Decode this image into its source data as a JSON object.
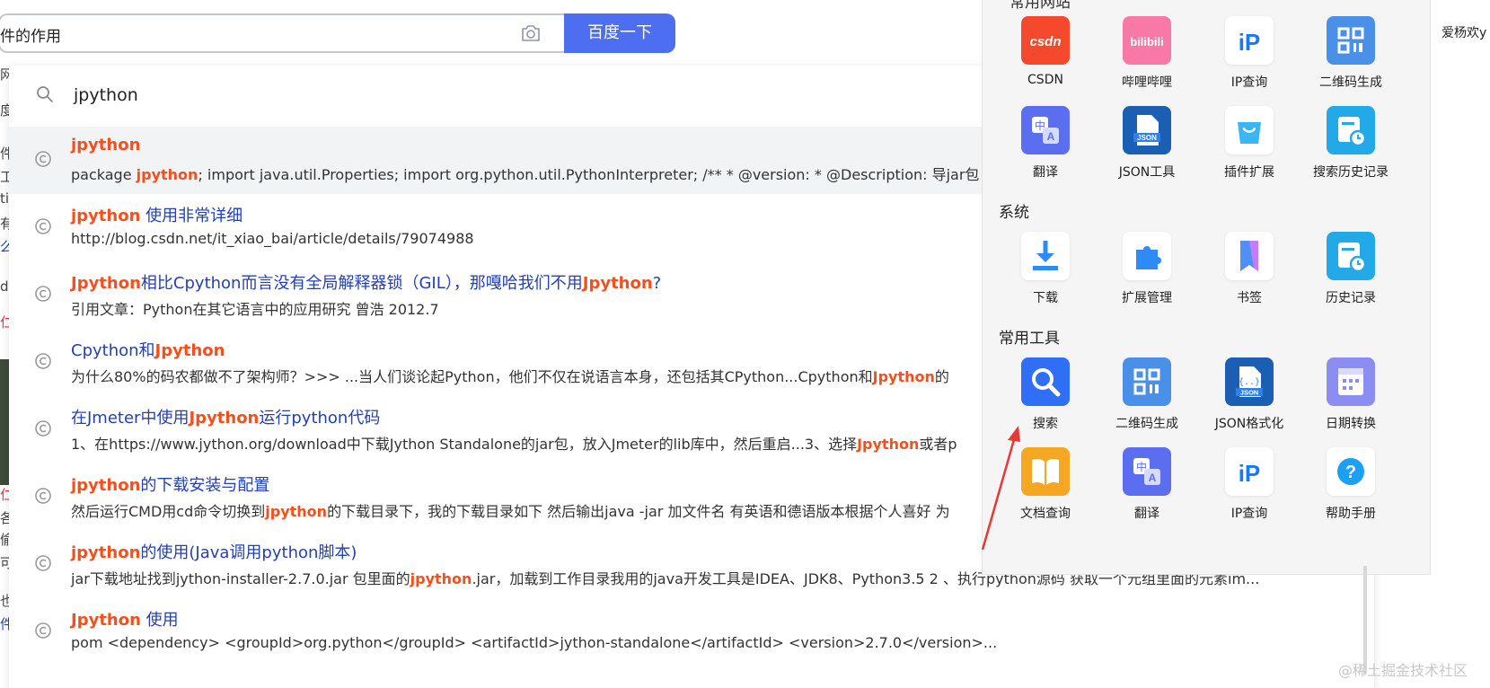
{
  "search": {
    "query": "件的作用",
    "button": "百度一下"
  },
  "left_fragments": {
    "f1": "网",
    "f2": "度",
    "f3": "件",
    "f4": "工",
    "f5": "tiv",
    "f6": "有",
    "f7": "么",
    "f8": "da",
    "f9": "仁",
    "f10": "仁",
    "f11": "各",
    "f12": "偷",
    "f13": "可",
    "f14": "也",
    "f15": "件"
  },
  "suggest": {
    "query": "jpython",
    "items": [
      {
        "title": [
          {
            "t": "jpython",
            "h": true
          }
        ],
        "desc": [
          {
            "t": "package ",
            "h": false
          },
          {
            "t": "jpython",
            "h": true
          },
          {
            "t": "; import java.util.Properties; import org.python.util.PythonInterpreter; /** * @version: * @Description: 导jar包",
            "h": false
          }
        ]
      },
      {
        "title": [
          {
            "t": "jpython",
            "h": true
          },
          {
            "t": " 使用非常详细",
            "h": false
          }
        ],
        "desc": [
          {
            "t": "http://blog.csdn.net/it_xiao_bai/article/details/79074988",
            "h": false
          }
        ]
      },
      {
        "title": [
          {
            "t": "Jpython",
            "h": true
          },
          {
            "t": "相比Cpython而言没有全局解释器锁（GIL），那嘎哈我们不用",
            "h": false
          },
          {
            "t": "Jpython",
            "h": true
          },
          {
            "t": "?",
            "h": false
          }
        ],
        "desc": [
          {
            "t": "引用文章：Python在其它语言中的应用研究 曾浩 2012.7",
            "h": false
          }
        ]
      },
      {
        "title": [
          {
            "t": "Cpython和",
            "h": false
          },
          {
            "t": "Jpython",
            "h": true
          }
        ],
        "desc": [
          {
            "t": "为什么80%的码农都做不了架构师？>>>   ...当人们谈论起Python，他们不仅在说语言本身，还包括其CPython...Cpython和",
            "h": false
          },
          {
            "t": "Jpython",
            "h": true
          },
          {
            "t": "的",
            "h": false
          }
        ]
      },
      {
        "title": [
          {
            "t": "在Jmeter中使用",
            "h": false
          },
          {
            "t": "Jpython",
            "h": true
          },
          {
            "t": "运行python代码",
            "h": false
          }
        ],
        "desc": [
          {
            "t": "1、在https://www.jython.org/download中下载Jython Standalone的jar包，放入Jmeter的lib库中，然后重启...3、选择",
            "h": false
          },
          {
            "t": "Jpython",
            "h": true
          },
          {
            "t": "或者p",
            "h": false
          }
        ]
      },
      {
        "title": [
          {
            "t": "jpython",
            "h": true
          },
          {
            "t": "的下载安装与配置",
            "h": false
          }
        ],
        "desc": [
          {
            "t": "然后运行CMD用cd命令切换到",
            "h": false
          },
          {
            "t": "jpython",
            "h": true
          },
          {
            "t": "的下载目录下，我的下载目录如下 然后输出java -jar 加文件名 有英语和德语版本根据个人喜好 为",
            "h": false
          }
        ]
      },
      {
        "title": [
          {
            "t": "jpython",
            "h": true
          },
          {
            "t": "的使用(Java调用python脚本)",
            "h": false
          }
        ],
        "desc": [
          {
            "t": "jar下载地址找到jython-installer-2.7.0.jar 包里面的",
            "h": false
          },
          {
            "t": "jpython",
            "h": true
          },
          {
            "t": ".jar，加载到工作目录我用的java开发工具是IDEA、JDK8、Python3.5 2 、执行python源码 获取一个元组里面的元素im...",
            "h": false
          }
        ]
      },
      {
        "title": [
          {
            "t": "Jpython",
            "h": true
          },
          {
            "t": " 使用",
            "h": false
          }
        ],
        "desc": [
          {
            "t": "pom <dependency> <groupId>org.python</groupId> <artifactId>jython-standalone</artifactId> <version>2.7.0</version>...",
            "h": false
          }
        ]
      }
    ]
  },
  "panel": {
    "top_cut_title": "常用网站",
    "row1": [
      {
        "label": "CSDN",
        "icon": "csdn-icon"
      },
      {
        "label": "哔哩哔哩",
        "icon": "bilibili-icon"
      },
      {
        "label": "IP查询",
        "icon": "ip-icon"
      },
      {
        "label": "二维码生成",
        "icon": "qrcode-icon"
      }
    ],
    "row2": [
      {
        "label": "翻译",
        "icon": "translate-icon"
      },
      {
        "label": "JSON工具",
        "icon": "json-file-icon"
      },
      {
        "label": "插件扩展",
        "icon": "bag-icon"
      },
      {
        "label": "搜索历史记录",
        "icon": "history-icon"
      }
    ],
    "section_system": "系统",
    "row3": [
      {
        "label": "下载",
        "icon": "download-icon"
      },
      {
        "label": "扩展管理",
        "icon": "puzzle-icon"
      },
      {
        "label": "书签",
        "icon": "bookmark-icon"
      },
      {
        "label": "历史记录",
        "icon": "history-icon"
      }
    ],
    "section_tools": "常用工具",
    "row4": [
      {
        "label": "搜索",
        "icon": "search-icon"
      },
      {
        "label": "二维码生成",
        "icon": "qrcode-icon"
      },
      {
        "label": "JSON格式化",
        "icon": "json-format-icon"
      },
      {
        "label": "日期转换",
        "icon": "calendar-icon"
      }
    ],
    "row5": [
      {
        "label": "文档查询",
        "icon": "book-icon"
      },
      {
        "label": "翻译",
        "icon": "translate-icon"
      },
      {
        "label": "IP查询",
        "icon": "ip-icon"
      },
      {
        "label": "帮助手册",
        "icon": "help-icon"
      }
    ]
  },
  "right_name": "爱杨欢y",
  "watermark": "@稀土掘金技术社区",
  "colors": {
    "accent": "#4e6ef2",
    "highlight": "#f3501e",
    "link": "#2440b3",
    "arrow": "#e53935"
  }
}
